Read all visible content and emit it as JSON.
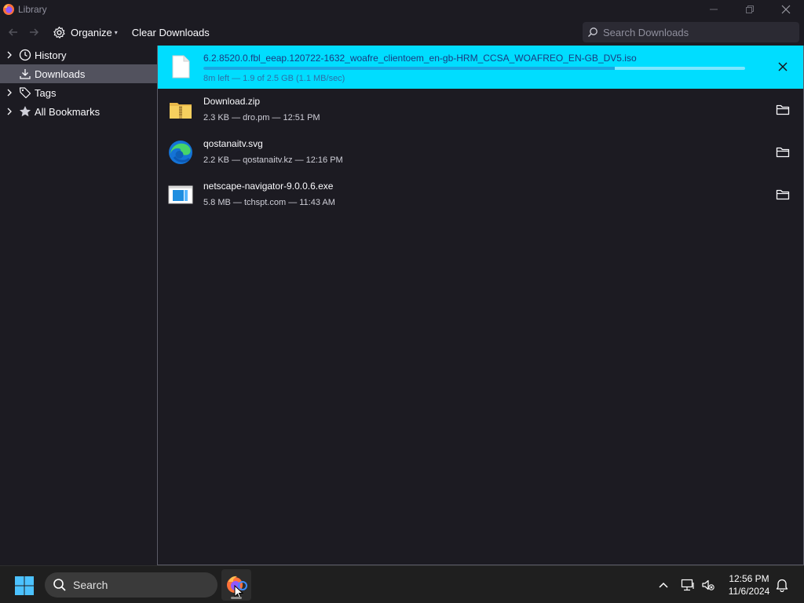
{
  "window": {
    "title": "Library"
  },
  "toolbar": {
    "organize_label": "Organize",
    "clear_label": "Clear Downloads",
    "search_placeholder": "Search Downloads"
  },
  "sidebar": {
    "items": [
      {
        "label": "History",
        "icon": "clock-icon",
        "expandable": true,
        "selected": false
      },
      {
        "label": "Downloads",
        "icon": "download-icon",
        "expandable": false,
        "selected": true
      },
      {
        "label": "Tags",
        "icon": "tag-icon",
        "expandable": true,
        "selected": false
      },
      {
        "label": "All Bookmarks",
        "icon": "star-icon",
        "expandable": true,
        "selected": false
      }
    ]
  },
  "downloads": [
    {
      "name": "6.2.8520.0.fbl_eeap.120722-1632_woafre_clientoem_en-gb-HRM_CCSA_WOAFREO_EN-GB_DV5.iso",
      "meta": "8m left — 1.9 of 2.5 GB (1.1 MB/sec)",
      "icon": "generic-file-icon",
      "progress": 0.76,
      "action": "cancel-icon"
    },
    {
      "name": "Download.zip",
      "meta": "2.3 KB — dro.pm — 12:51 PM",
      "icon": "zip-folder-icon",
      "action": "folder-icon"
    },
    {
      "name": "qostanaitv.svg",
      "meta": "2.2 KB — qostanaitv.kz — 12:16 PM",
      "icon": "edge-icon",
      "action": "folder-icon"
    },
    {
      "name": "netscape-navigator-9.0.0.6.exe",
      "meta": "5.8 MB — tchspt.com — 11:43 AM",
      "icon": "exe-window-icon",
      "action": "folder-icon"
    }
  ],
  "taskbar": {
    "search_label": "Search",
    "time": "12:56 PM",
    "date": "11/6/2024"
  },
  "colors": {
    "accent": "#00ddff",
    "background": "#1c1b22",
    "selected": "#52525e"
  }
}
